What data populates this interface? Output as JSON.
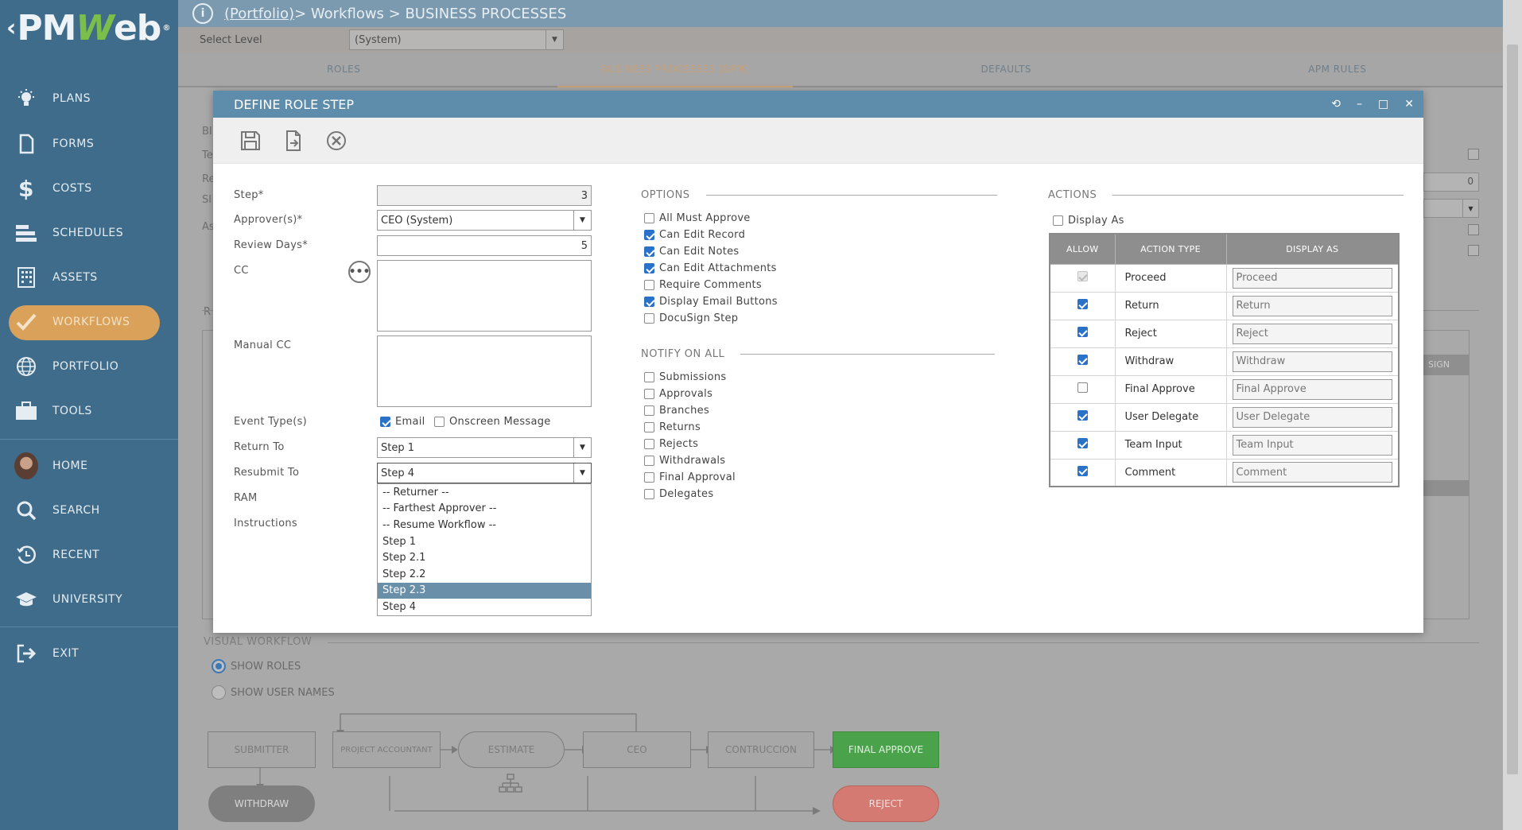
{
  "sidebar": {
    "logo": {
      "chev": "‹",
      "pm": "PM",
      "w": "W",
      "eb": "eb",
      "reg": "®"
    },
    "items": [
      {
        "label": "PLANS",
        "icon": "lightbulb-icon"
      },
      {
        "label": "FORMS",
        "icon": "document-icon"
      },
      {
        "label": "COSTS",
        "icon": "dollar-icon"
      },
      {
        "label": "SCHEDULES",
        "icon": "schedule-bars-icon"
      },
      {
        "label": "ASSETS",
        "icon": "building-icon"
      },
      {
        "label": "WORKFLOWS",
        "icon": "checkmark-icon"
      },
      {
        "label": "PORTFOLIO",
        "icon": "globe-icon"
      },
      {
        "label": "TOOLS",
        "icon": "briefcase-icon"
      },
      {
        "label": "HOME",
        "icon": "avatar"
      },
      {
        "label": "SEARCH",
        "icon": "search-icon"
      },
      {
        "label": "RECENT",
        "icon": "history-icon"
      },
      {
        "label": "UNIVERSITY",
        "icon": "graduation-cap-icon"
      },
      {
        "label": "EXIT",
        "icon": "exit-icon"
      }
    ]
  },
  "header": {
    "info": "i",
    "portfolio_link": "(Portfolio)",
    "breadcrumb_rest": " > Workflows > BUSINESS PROCESSES"
  },
  "level": {
    "label": "Select Level",
    "value": "(System)"
  },
  "tabs": [
    {
      "label": "ROLES"
    },
    {
      "label": "BUSINESS PROCESSES (BPM)"
    },
    {
      "label": "DEFAULTS"
    },
    {
      "label": "APM RULES"
    }
  ],
  "background": {
    "fragments": [
      "BI",
      "Te",
      "Re",
      "Sl",
      "As",
      "R",
      "SIGN"
    ],
    "value_0": "0"
  },
  "modal": {
    "title": "DEFINE ROLE STEP",
    "controls": {
      "refresh": "⟲",
      "minimize": "–",
      "maximize": "□",
      "close": "✕"
    },
    "form": {
      "step_label": "Step*",
      "step_value": "3",
      "approver_label": "Approver(s)*",
      "approver_value": "CEO (System)",
      "review_days_label": "Review Days*",
      "review_days_value": "5",
      "cc_label": "CC",
      "cc_button": "•••",
      "manual_cc_label": "Manual CC",
      "event_types_label": "Event Type(s)",
      "event_email": "Email",
      "event_onscreen": "Onscreen Message",
      "return_to_label": "Return To",
      "return_to_value": "Step 1",
      "resubmit_to_label": "Resubmit To",
      "resubmit_to_value": "Step 4",
      "ram_label": "RAM",
      "instructions_label": "Instructions",
      "dropdown_arrow": "▼"
    },
    "resubmit_options": [
      "-- Returner --",
      "-- Farthest Approver --",
      "-- Resume Workflow --",
      "Step 1",
      "Step 2.1",
      "Step 2.2",
      "Step 2.3",
      "Step 4"
    ],
    "options_title": "OPTIONS",
    "options": [
      {
        "label": "All Must Approve",
        "checked": false
      },
      {
        "label": "Can Edit Record",
        "checked": true
      },
      {
        "label": "Can Edit Notes",
        "checked": true
      },
      {
        "label": "Can Edit Attachments",
        "checked": true
      },
      {
        "label": "Require Comments",
        "checked": false
      },
      {
        "label": "Display Email Buttons",
        "checked": true
      },
      {
        "label": "DocuSign Step",
        "checked": false
      }
    ],
    "notify_title": "NOTIFY ON ALL",
    "notify": [
      {
        "label": "Submissions",
        "checked": false
      },
      {
        "label": "Approvals",
        "checked": false
      },
      {
        "label": "Branches",
        "checked": false
      },
      {
        "label": "Returns",
        "checked": false
      },
      {
        "label": "Rejects",
        "checked": false
      },
      {
        "label": "Withdrawals",
        "checked": false
      },
      {
        "label": "Final Approval",
        "checked": false
      },
      {
        "label": "Delegates",
        "checked": false
      }
    ],
    "actions_title": "ACTIONS",
    "display_as_label": "Display As",
    "actions_headers": {
      "allow": "ALLOW",
      "type": "ACTION TYPE",
      "display": "DISPLAY AS"
    },
    "actions": [
      {
        "type": "Proceed",
        "display": "Proceed",
        "allow": "disabled"
      },
      {
        "type": "Return",
        "display": "Return",
        "allow": "on"
      },
      {
        "type": "Reject",
        "display": "Reject",
        "allow": "on"
      },
      {
        "type": "Withdraw",
        "display": "Withdraw",
        "allow": "on"
      },
      {
        "type": "Final Approve",
        "display": "Final Approve",
        "allow": "off"
      },
      {
        "type": "User Delegate",
        "display": "User Delegate",
        "allow": "on"
      },
      {
        "type": "Team Input",
        "display": "Team Input",
        "allow": "on"
      },
      {
        "type": "Comment",
        "display": "Comment",
        "allow": "on"
      }
    ]
  },
  "visual_workflow": {
    "title": "VISUAL WORKFLOW",
    "show_roles": "SHOW ROLES",
    "show_user_names": "SHOW USER NAMES",
    "nodes": {
      "submitter": "SUBMITTER",
      "project_accountant": "PROJECT ACCOUNTANT",
      "estimate": "ESTIMATE",
      "ceo": "CEO",
      "contruccion": "CONTRUCCION",
      "final_approve": "FINAL APPROVE",
      "withdraw": "WITHDRAW",
      "reject": "REJECT"
    }
  },
  "colors": {
    "sidebar": "#3f6c8a",
    "accent_active": "#d9a15a",
    "modal_header": "#5e8cab",
    "checkbox_on": "#2a72c7",
    "final_approve": "#4aa24a",
    "reject": "#d57a72"
  }
}
